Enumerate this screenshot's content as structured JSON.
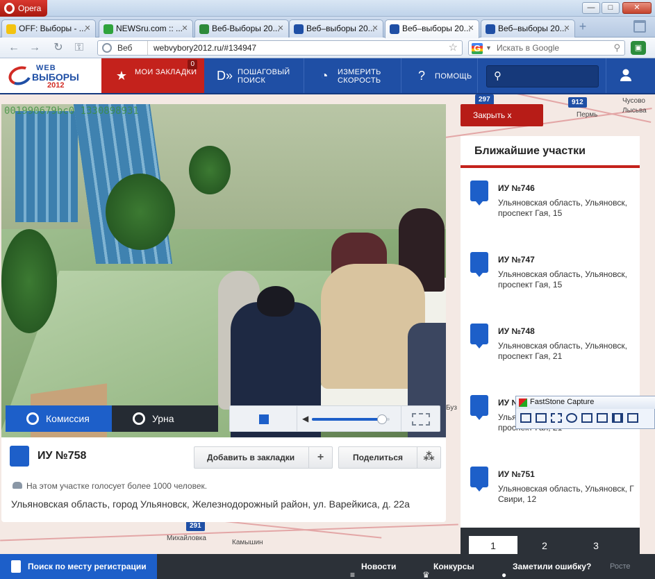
{
  "window": {
    "app_button": "Opera",
    "controls": {
      "minimize": "—",
      "maximize": "□",
      "close": "✕"
    }
  },
  "tabs": [
    {
      "label": "OFF: Выборы - ...",
      "icon_color": "#f3c310",
      "active": false
    },
    {
      "label": "NEWSru.com :: ...",
      "icon_color": "#2fa33c",
      "active": false
    },
    {
      "label": "Веб-Выборы 20...",
      "icon_color": "#2d8a3a",
      "active": false
    },
    {
      "label": "Веб–выборы 20...",
      "icon_color": "#1f4fa5",
      "active": false
    },
    {
      "label": "Веб–выборы 20...",
      "icon_color": "#1f4fa5",
      "active": true
    },
    {
      "label": "Веб–выборы 20...",
      "icon_color": "#1f4fa5",
      "active": false
    }
  ],
  "address_bar": {
    "web_label": "Веб",
    "url": "webvybory2012.ru/#134947"
  },
  "search": {
    "placeholder": "Искать в Google",
    "engine": "G"
  },
  "site": {
    "logo": {
      "line1": "WEB",
      "line2": "ВЫБОРЫ",
      "line3": "2012"
    },
    "nav": {
      "bookmarks": {
        "label": "МОИ ЗАКЛАДКИ",
        "count": "0",
        "icon": "star-icon"
      },
      "route": {
        "label": "ПОШАГОВЫЙ ПОИСК",
        "icon": "arrows-icon"
      },
      "speed": {
        "label": "ИЗМЕРИТЬ СКОРОСТЬ",
        "icon": "speedometer-icon"
      },
      "help": {
        "label": "ПОМОЩЬ",
        "icon": "question-icon"
      }
    }
  },
  "map": {
    "markers": [
      "912",
      "297",
      "291"
    ],
    "labels": [
      "Пермь",
      "Чусово",
      "Лысьва",
      "Михайловка",
      "Камышин",
      "Буз"
    ]
  },
  "video": {
    "overlay_id": "001990679bc0 1330898931",
    "camera_tabs": {
      "commission": "Комиссия",
      "urn": "Урна"
    },
    "volume_percent": 90
  },
  "station": {
    "title": "ИУ №758",
    "bookmark_button": "Добавить в закладки",
    "share_button": "Поделиться",
    "voters_note": "На этом участке голосует более 1000 человек.",
    "address": "Ульяновская область, город Ульяновск, Железнодорожный район, ул. Варейкиса, д. 22а"
  },
  "sidebar": {
    "close_button": "Закрыть  x",
    "heading": "Ближайшие участки",
    "stations": [
      {
        "name": "ИУ №746",
        "address": "Ульяновская область, Ульяновск, проспект Гая, 15"
      },
      {
        "name": "ИУ №747",
        "address": "Ульяновская область, Ульяновск, проспект Гая, 15"
      },
      {
        "name": "ИУ №748",
        "address": "Ульяновская область, Ульяновск, проспект Гая, 21"
      },
      {
        "name": "ИУ №",
        "address": "Ульяновская область, Ульяновск, проспект Гая, 21"
      },
      {
        "name": "ИУ №751",
        "address": "Ульяновская область, Ульяновск, Г Свири, 12"
      }
    ],
    "pages": [
      "1",
      "2",
      "3"
    ],
    "active_page": "1"
  },
  "faststone": {
    "title": "FastStone Capture"
  },
  "bottom": {
    "register_search": "Поиск по месту регистрации",
    "news": "Новости",
    "contests": "Конкурсы",
    "report_error": "Заметили ошибку?",
    "rost": "Росте"
  }
}
